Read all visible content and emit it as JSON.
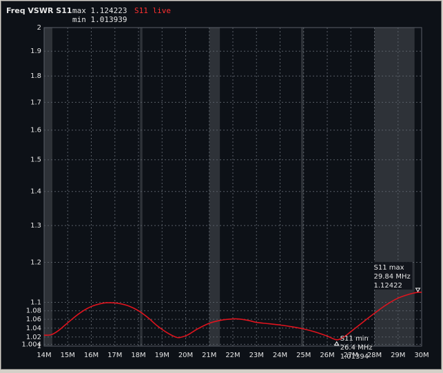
{
  "header": {
    "title": "Freq VSWR S11",
    "max_text": "max 1.124223",
    "min_text": "min 1.013939",
    "live_label": "S11 live"
  },
  "colors": {
    "background": "#0d1117",
    "grid": "#5a6068",
    "trace": "#e0141e",
    "band": "#2e3238",
    "text": "#e6e6e6",
    "live": "#ff3030"
  },
  "chart_data": {
    "type": "line",
    "title": "Freq VSWR S11",
    "xlabel": "",
    "ylabel": "",
    "xlim": [
      14,
      30
    ],
    "ylim": [
      1,
      2
    ],
    "y_scale": "log",
    "grid": true,
    "x_ticks": [
      14,
      15,
      16,
      17,
      18,
      19,
      20,
      21,
      22,
      23,
      24,
      25,
      26,
      27,
      28,
      29,
      30
    ],
    "x_tick_labels": [
      "14M",
      "15M",
      "16M",
      "17M",
      "18M",
      "19M",
      "20M",
      "21M",
      "22M",
      "23M",
      "24M",
      "25M",
      "26M",
      "27M",
      "28M",
      "29M",
      "30M"
    ],
    "y_ticks": [
      1,
      1.004,
      1.02,
      1.04,
      1.06,
      1.08,
      1.1,
      1.2,
      1.3,
      1.4,
      1.5,
      1.6,
      1.7,
      1.8,
      1.9,
      2
    ],
    "y_tick_labels": [
      "1",
      "1.004",
      "1.02",
      "1.04",
      "1.06",
      "1.08",
      "1.1",
      "1.2",
      "1.3",
      "1.4",
      "1.5",
      "1.6",
      "1.7",
      "1.8",
      "1.9",
      "2"
    ],
    "bands": [
      [
        14.0,
        14.35
      ],
      [
        18.068,
        18.168
      ],
      [
        21.0,
        21.45
      ],
      [
        24.89,
        24.99
      ],
      [
        28.0,
        29.7
      ]
    ],
    "series": [
      {
        "name": "S11 live",
        "x": [
          14.0,
          14.3,
          14.6,
          15.0,
          15.5,
          16.0,
          16.5,
          16.8,
          17.2,
          17.6,
          18.0,
          18.4,
          18.8,
          19.2,
          19.6,
          19.8,
          20.1,
          20.5,
          21.0,
          21.5,
          22.0,
          22.3,
          22.7,
          23.0,
          23.5,
          24.0,
          24.5,
          25.0,
          25.5,
          26.0,
          26.4,
          26.7,
          27.0,
          27.5,
          28.0,
          28.5,
          29.0,
          29.5,
          29.84,
          30.0
        ],
        "y": [
          1.024,
          1.025,
          1.034,
          1.052,
          1.074,
          1.09,
          1.098,
          1.099,
          1.097,
          1.091,
          1.08,
          1.064,
          1.045,
          1.03,
          1.0195,
          1.0195,
          1.025,
          1.038,
          1.051,
          1.058,
          1.061,
          1.0605,
          1.057,
          1.053,
          1.05,
          1.047,
          1.043,
          1.038,
          1.031,
          1.022,
          1.01394,
          1.02,
          1.032,
          1.053,
          1.074,
          1.094,
          1.11,
          1.12,
          1.12422,
          1.1242
        ]
      }
    ],
    "markers": [
      {
        "name": "S11 max",
        "label": "S11 max",
        "freq_text": "29.84 MHz",
        "value_text": "1.12422",
        "x": 29.84,
        "y": 1.12422,
        "direction": "down"
      },
      {
        "name": "S11 min",
        "label": "S11 min",
        "freq_text": "26.4 MHz",
        "value_text": "1.01394",
        "x": 26.4,
        "y": 1.01394,
        "direction": "up"
      }
    ]
  }
}
